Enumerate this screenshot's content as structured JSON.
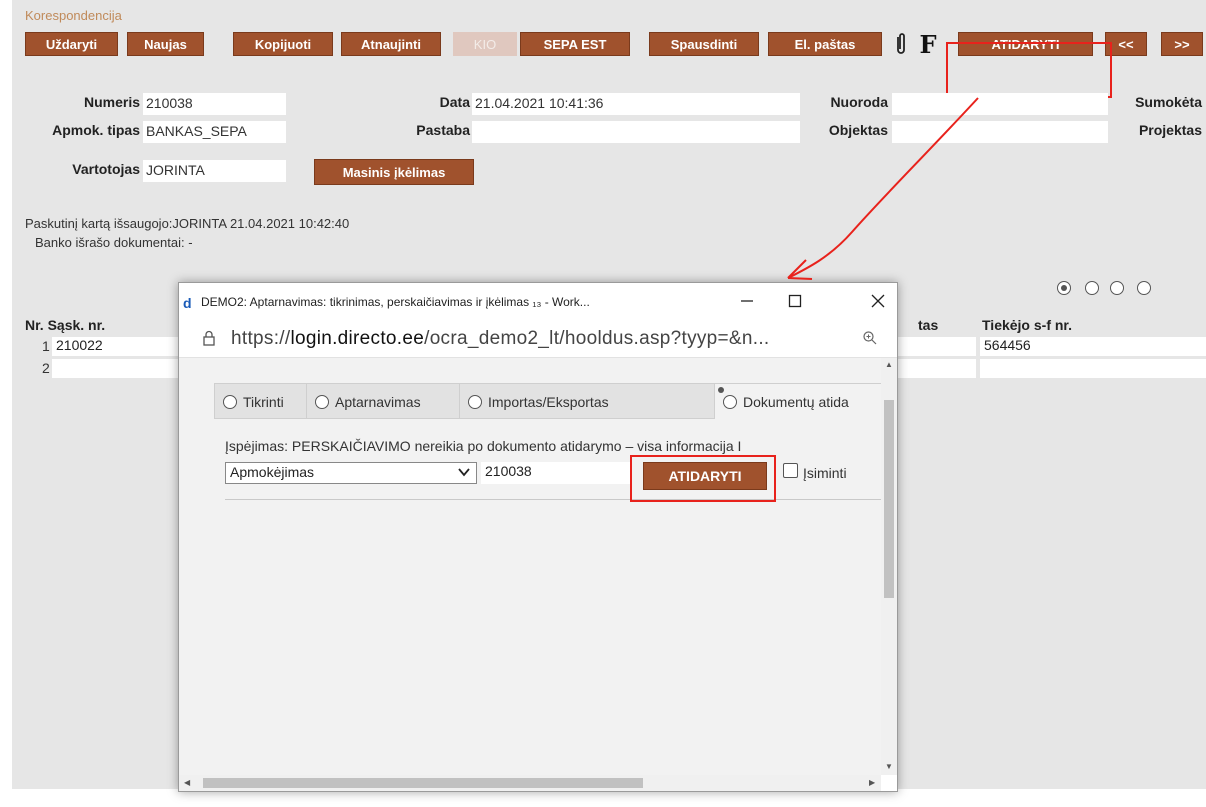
{
  "section_title": "Korespondencija",
  "toolbar": {
    "close": "Uždaryti",
    "new": "Naujas",
    "copy": "Kopijuoti",
    "refresh": "Atnaujinti",
    "kio": "KIO",
    "sepa": "SEPA EST",
    "print": "Spausdinti",
    "email": "El. paštas",
    "f_label": "F",
    "open": "ATIDARYTI",
    "prev": "<<",
    "next": ">>"
  },
  "form": {
    "numeris_label": "Numeris",
    "numeris_value": "210038",
    "data_label": "Data",
    "data_value": "21.04.2021 10:41:36",
    "nuoroda_label": "Nuoroda",
    "nuoroda_value": "",
    "sumoketa_label": "Sumokėta",
    "apmok_label": "Apmok. tipas",
    "apmok_value": "BANKAS_SEPA",
    "pastaba_label": "Pastaba",
    "pastaba_value": "",
    "objektas_label": "Objektas",
    "objektas_value": "",
    "projektas_label": "Projektas",
    "vartotojas_label": "Vartotojas",
    "vartotojas_value": "JORINTA",
    "mass_import": "Masinis įkėlimas"
  },
  "info": {
    "last_saved": "Paskutinį kartą išsaugojo:JORINTA 21.04.2021 10:42:40",
    "bank_docs": "Banko išrašo dokumentai: -"
  },
  "table": {
    "col_nr": "Nr. Sąsk. nr.",
    "col_tas": "tas",
    "col_tiekejo": "Tiekėjo s-f nr.",
    "rows": [
      {
        "nr": "1",
        "sask": "210022",
        "tiekejo": "564456"
      },
      {
        "nr": "2",
        "sask": "",
        "tiekejo": ""
      }
    ]
  },
  "popup": {
    "logo": "d",
    "title": "DEMO2: Aptarnavimas: tikrinimas, perskaičiavimas ir įkėlimas ₁₃ - Work...",
    "url_prefix": "https://",
    "url_domain": "login.directo.ee",
    "url_path": "/ocra_demo2_lt/hooldus.asp?tyyp=&n...",
    "tabs": [
      "Tikrinti",
      "Aptarnavimas",
      "Importas/Eksportas",
      "Dokumentų atida"
    ],
    "warning": "Įspėjimas: PERSKAIČIAVIMO nereikia po dokumento atidarymo – visa informacija I",
    "select_value": "Apmokėjimas",
    "number_value": "210038",
    "open_button": "ATIDARYTI",
    "remember_label": "Įsiminti"
  },
  "colors": {
    "brown_button": "#a0522d",
    "annotation_red": "#e8221c",
    "background": "#e6e6e6"
  }
}
